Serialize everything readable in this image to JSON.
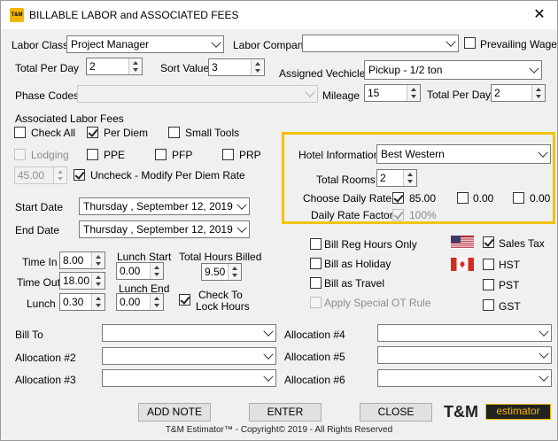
{
  "window": {
    "title": "BILLABLE LABOR and ASSOCIATED FEES",
    "logo_text": "T&M",
    "close_glyph": "✕"
  },
  "labor_class": {
    "label": "Labor Class",
    "value": "Project Manager"
  },
  "labor_company": {
    "label": "Labor Company",
    "value": ""
  },
  "prevailing_wage": {
    "label": "Prevailing Wage",
    "checked": false
  },
  "total_per_day": {
    "label": "Total Per Day",
    "value": "2"
  },
  "sort_value": {
    "label": "Sort Value",
    "value": "3"
  },
  "assigned_vehicle": {
    "label": "Assigned Vechicle",
    "value": "Pickup - 1/2 ton"
  },
  "phase_codes": {
    "label": "Phase Codes",
    "value": ""
  },
  "mileage": {
    "label": "Mileage",
    "value": "15"
  },
  "vehicle_total_per_day": {
    "label": "Total Per Day",
    "value": "2"
  },
  "associated_fees": {
    "heading": "Associated Labor Fees",
    "check_all": {
      "label": "Check All",
      "checked": false
    },
    "per_diem": {
      "label": "Per Diem",
      "checked": true
    },
    "small_tools": {
      "label": "Small Tools",
      "checked": false
    },
    "lodging": {
      "label": "Lodging",
      "checked": false
    },
    "ppe": {
      "label": "PPE",
      "checked": false
    },
    "pfp": {
      "label": "PFP",
      "checked": false
    },
    "prp": {
      "label": "PRP",
      "checked": false
    },
    "per_diem_rate": "45.00",
    "uncheck_modify": {
      "label": "Uncheck - Modify Per Diem Rate",
      "checked": true
    }
  },
  "hotel": {
    "info_label": "Hotel Information",
    "info_value": "Best Western",
    "total_rooms_label": "Total Rooms",
    "total_rooms_value": "2",
    "choose_rate_label": "Choose Daily Rate",
    "rates": [
      {
        "value": "85.00",
        "checked": true
      },
      {
        "value": "0.00",
        "checked": false
      },
      {
        "value": "0.00",
        "checked": false
      }
    ],
    "rate_factor_label": "Daily Rate Factor",
    "rate_factor_value": "100%"
  },
  "start_date": {
    "label": "Start Date",
    "value": "Thursday   , September 12, 2019"
  },
  "end_date": {
    "label": "End Date",
    "value": "Thursday   , September 12, 2019"
  },
  "time": {
    "time_in_label": "Time In",
    "time_in": "8.00",
    "time_out_label": "Time Out",
    "time_out": "18.00",
    "lunch_label": "Lunch",
    "lunch": "0.30",
    "lunch_start_label": "Lunch Start",
    "lunch_start": "0.00",
    "lunch_end_label": "Lunch End",
    "lunch_end": "0.00",
    "total_hours_label": "Total Hours Billed",
    "total_hours": "9.50",
    "check_to_lock_label_1": "Check To",
    "check_to_lock_label_2": "Lock Hours"
  },
  "billing_options": {
    "bill_reg_hours": "Bill Reg Hours Only",
    "bill_holiday": "Bill as Holiday",
    "bill_travel": "Bill as Travel",
    "special_ot": "Apply Special OT Rule"
  },
  "taxes": {
    "sales_tax": {
      "label": "Sales Tax",
      "checked": true
    },
    "hst": {
      "label": "HST",
      "checked": false
    },
    "pst": {
      "label": "PST",
      "checked": false
    },
    "gst": {
      "label": "GST",
      "checked": false
    },
    "us_flag_icon": "us-flag-icon",
    "ca_flag_icon": "canada-flag-icon"
  },
  "allocations": {
    "bill_to": "Bill To",
    "alloc2": "Allocation #2",
    "alloc3": "Allocation #3",
    "alloc4": "Allocation #4",
    "alloc5": "Allocation #5",
    "alloc6": "Allocation #6"
  },
  "buttons": {
    "add_note": "ADD NOTE",
    "enter": "ENTER",
    "close": "CLOSE"
  },
  "brand": {
    "tm": "T&M",
    "estimator": "estimator"
  },
  "footer": "T&M Estimator™ - Copyright© 2019 - All Rights Reserved",
  "colors": {
    "highlight": "#f2c300",
    "brand_yellow": "#f2b600"
  }
}
